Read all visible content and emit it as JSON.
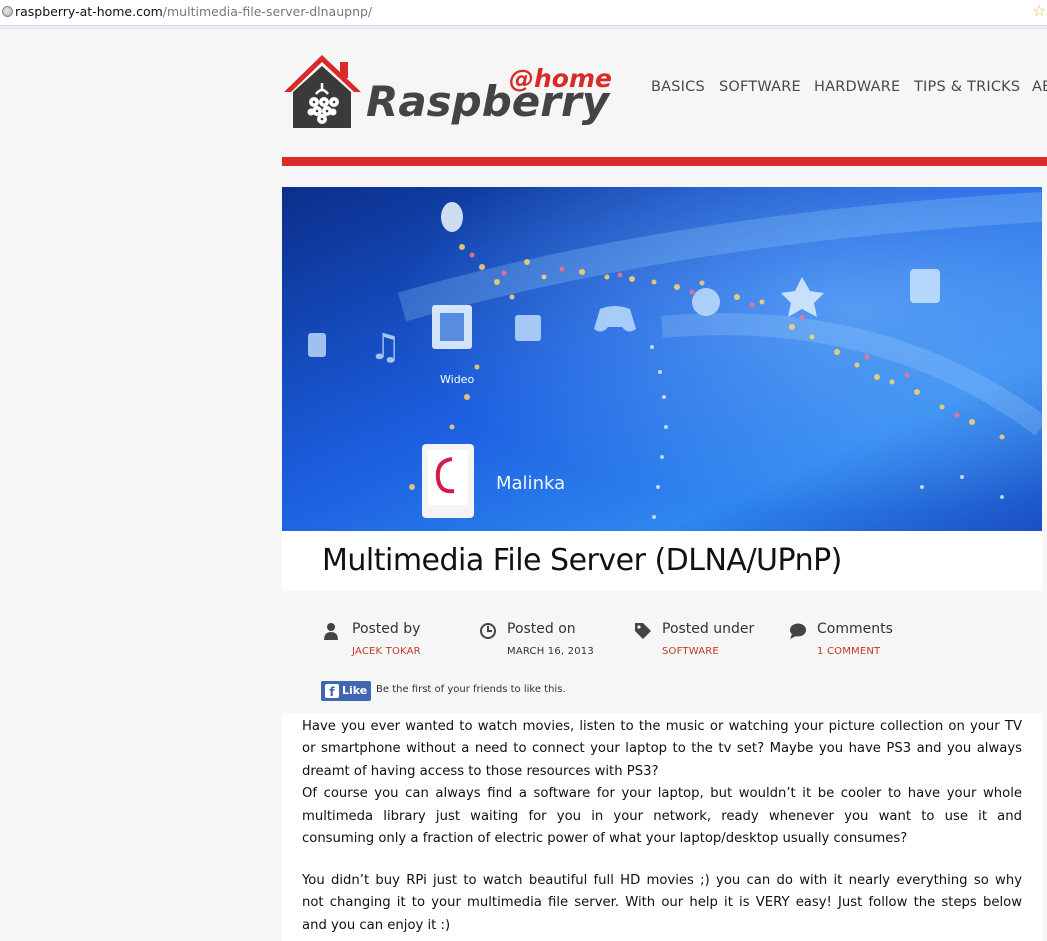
{
  "browser": {
    "url_host": "raspberry-at-home.com",
    "url_path": "/multimedia-file-server-dlnaupnp/"
  },
  "site": {
    "logo_at_home": "@home",
    "logo_name": "Raspberry",
    "nav": [
      "BASICS",
      "SOFTWARE",
      "HARDWARE",
      "TIPS & TRICKS",
      "AB"
    ]
  },
  "hero": {
    "label_video": "Wideo",
    "label_malinka": "Malinka"
  },
  "post": {
    "title": "Multimedia File Server (DLNA/UPnP)",
    "meta": [
      {
        "label": "Posted by",
        "value": "JACEK TOKAR"
      },
      {
        "label": "Posted on",
        "value": "MARCH 16, 2013"
      },
      {
        "label": "Posted under",
        "value": "SOFTWARE"
      },
      {
        "label": "Comments",
        "value": "1 COMMENT"
      }
    ],
    "like_label": "Like",
    "like_text": "Be the first of your friends to like this.",
    "paragraph1_lines": [
      "Have you ever wanted to watch movies, listen to the music or watching your picture collection on your TV",
      "or smartphone without a need to connect your laptop to the tv set? Maybe you have PS3 and you always",
      "dreamt of having access to those resources with PS3?",
      "Of course you can always find a software for your laptop, but wouldn’t it be cooler to have your whole",
      "multimeda library just waiting for you in your network, ready whenever you want to use it and",
      "consuming only a fraction of electric power of what your laptop/desktop usually consumes?"
    ],
    "paragraph2_lines": [
      "You didn’t buy RPi just to watch beautiful full HD movies ;) you can do with it nearly everything so why",
      "not changing it to your multimedia file server. With our help it is VERY easy! Just follow the steps below",
      "and you can enjoy it :)"
    ]
  },
  "colors": {
    "accent_red": "#d92a2a",
    "link_red": "#c0392b",
    "facebook_blue": "#4267b2",
    "hero_blue": "#1f5fd6"
  },
  "icons": {
    "author": "person-icon",
    "date": "clock-icon",
    "category": "tag-icon",
    "comments": "speech-bubble-icon"
  }
}
